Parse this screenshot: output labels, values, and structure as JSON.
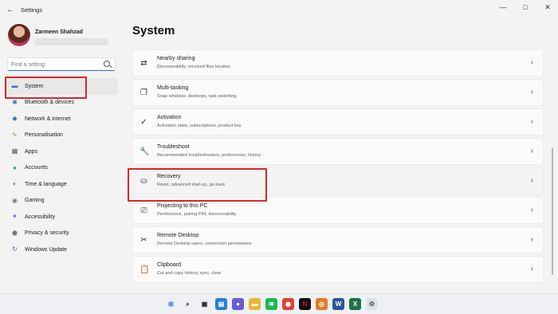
{
  "window": {
    "title": "Settings",
    "back_glyph": "←",
    "min_glyph": "—",
    "max_glyph": "□",
    "close_glyph": "✕"
  },
  "profile": {
    "name": "Zarmeen Shahzad"
  },
  "search": {
    "placeholder": "Find a setting"
  },
  "sidebar": {
    "items": [
      {
        "label": "System",
        "icon": "monitor-icon",
        "glyph": "▬",
        "color": "#2b6fd6",
        "active": true
      },
      {
        "label": "Bluetooth & devices",
        "icon": "bluetooth-icon",
        "glyph": "✱",
        "color": "#2b6fd6"
      },
      {
        "label": "Network & internet",
        "icon": "wifi-icon",
        "glyph": "◆",
        "color": "#2b6fd6"
      },
      {
        "label": "Personalisation",
        "icon": "brush-icon",
        "glyph": "✎",
        "color": "#c98a2b"
      },
      {
        "label": "Apps",
        "icon": "apps-icon",
        "glyph": "▦",
        "color": "#555"
      },
      {
        "label": "Accounts",
        "icon": "person-icon",
        "glyph": "●",
        "color": "#2fa36b"
      },
      {
        "label": "Time & language",
        "icon": "globe-icon",
        "glyph": "◐",
        "color": "#2b6fd6"
      },
      {
        "label": "Gaming",
        "icon": "gamepad-icon",
        "glyph": "◉",
        "color": "#777"
      },
      {
        "label": "Accessibility",
        "icon": "accessibility-icon",
        "glyph": "✦",
        "color": "#2b6fd6"
      },
      {
        "label": "Privacy & security",
        "icon": "shield-icon",
        "glyph": "⬟",
        "color": "#777"
      },
      {
        "label": "Windows Update",
        "icon": "update-icon",
        "glyph": "↻",
        "color": "#2b6fd6"
      }
    ]
  },
  "main": {
    "title": "System",
    "items": [
      {
        "title": "Nearby sharing",
        "subtitle": "Discoverability, received files location",
        "icon": "share-icon",
        "glyph": "⇄"
      },
      {
        "title": "Multi-tasking",
        "subtitle": "Snap windows, desktops, task switching",
        "icon": "multitask-icon",
        "glyph": "❐"
      },
      {
        "title": "Activation",
        "subtitle": "Activation state, subscriptions, product key",
        "icon": "check-circle-icon",
        "glyph": "✓"
      },
      {
        "title": "Troubleshoot",
        "subtitle": "Recommended troubleshooters, preferences, history",
        "icon": "wrench-icon",
        "glyph": "🔧"
      },
      {
        "title": "Recovery",
        "subtitle": "Reset, advanced start-up, go back",
        "icon": "recovery-icon",
        "glyph": "⛀",
        "hover": true
      },
      {
        "title": "Projecting to this PC",
        "subtitle": "Permissions, pairing PIN, discoverability",
        "icon": "projector-icon",
        "glyph": "⎚"
      },
      {
        "title": "Remote Desktop",
        "subtitle": "Remote Desktop users, connection permissions",
        "icon": "remote-icon",
        "glyph": "✂"
      },
      {
        "title": "Clipboard",
        "subtitle": "Cut and copy history, sync, clear",
        "icon": "clipboard-icon",
        "glyph": "📋"
      }
    ],
    "chevron": "›"
  },
  "taskbar": {
    "icons": [
      {
        "name": "start-icon",
        "glyph": "⊞",
        "color": "#2b6fd6",
        "bg": "transparent"
      },
      {
        "name": "taskbar-search-icon",
        "glyph": "⌕",
        "color": "#222",
        "bg": "transparent"
      },
      {
        "name": "task-view-icon",
        "glyph": "▣",
        "color": "#222",
        "bg": "transparent"
      },
      {
        "name": "widgets-icon",
        "glyph": "▤",
        "color": "#fff",
        "bg": "#2b7fd6"
      },
      {
        "name": "chat-icon",
        "glyph": "●",
        "color": "#fff",
        "bg": "#6a5bd6"
      },
      {
        "name": "file-explorer-icon",
        "glyph": "▬",
        "color": "#fff",
        "bg": "#e6b73a"
      },
      {
        "name": "spotify-icon",
        "glyph": "≋",
        "color": "#fff",
        "bg": "#1db954"
      },
      {
        "name": "chrome-icon",
        "glyph": "◉",
        "color": "#fff",
        "bg": "#db4437"
      },
      {
        "name": "netflix-icon",
        "glyph": "N",
        "color": "#e50914",
        "bg": "#111"
      },
      {
        "name": "photos-icon",
        "glyph": "◎",
        "color": "#fff",
        "bg": "#e07a2b"
      },
      {
        "name": "word-icon",
        "glyph": "W",
        "color": "#fff",
        "bg": "#2b579a"
      },
      {
        "name": "excel-icon",
        "glyph": "X",
        "color": "#fff",
        "bg": "#217346"
      },
      {
        "name": "settings-taskbar-icon",
        "glyph": "⚙",
        "color": "#555",
        "bg": "#dde3ea"
      }
    ]
  }
}
